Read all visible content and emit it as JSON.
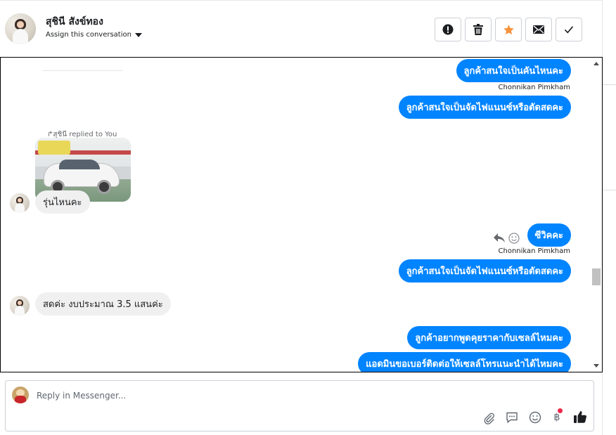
{
  "header": {
    "contact_name": "สุชินี สังข์ทอง",
    "assign_label": "Assign this conversation",
    "buttons": [
      {
        "name": "spam-button",
        "icon": "exclamation-icon"
      },
      {
        "name": "delete-button",
        "icon": "trash-icon"
      },
      {
        "name": "star-button",
        "icon": "star-icon",
        "color": "#f7923b"
      },
      {
        "name": "mail-button",
        "icon": "envelope-icon"
      },
      {
        "name": "done-button",
        "icon": "check-icon"
      }
    ]
  },
  "chat": {
    "messages": [
      {
        "dir": "out",
        "text": "ลูกค้าสนใจเป็นคันไหนคะ",
        "sender": "Chonnikan Pimkham"
      },
      {
        "dir": "out",
        "text": "ลูกค้าสนใจเป็นจัดไฟแนนซ์หรือตัดสดคะ"
      },
      {
        "dir": "in",
        "reply_note": "สุชินี replied to You",
        "image": "car-photo"
      },
      {
        "dir": "in",
        "text": "รุ่นไหนคะ"
      },
      {
        "dir": "out",
        "text": "ซีวิคคะ",
        "sender": "Chonnikan Pimkham"
      },
      {
        "dir": "out",
        "text": "ลูกค้าสนใจเป็นจัดไฟแนนซ์หรือตัดสดคะ"
      },
      {
        "dir": "in",
        "text": "สดค่ะ งบประมาณ 3.5 แสนค่ะ"
      },
      {
        "dir": "out",
        "text": "ลูกค้าอยากพูดคุยราคากับเซลล์ไหมคะ"
      },
      {
        "dir": "out",
        "text": "แอดมินขอเบอร์ติดต่อให้เซลล์โทรแนะนำได้ไหมคะ"
      }
    ]
  },
  "reply": {
    "placeholder": "Reply in Messenger...",
    "tools": [
      "attachment-icon",
      "saved-replies-icon",
      "emoji-icon",
      "payment-baht-icon",
      "like-icon"
    ],
    "baht_symbol": "฿"
  },
  "colors": {
    "bubble_out": "#0084ff",
    "bubble_in": "#f0f0f0",
    "notification_dot": "#f02849"
  }
}
